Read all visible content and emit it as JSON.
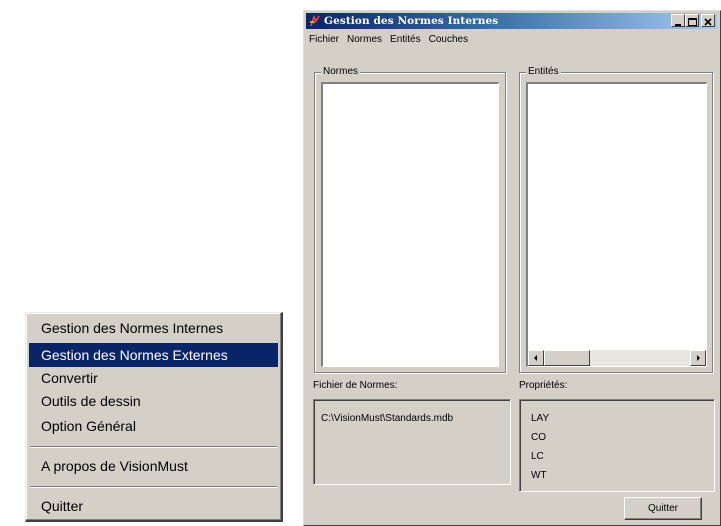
{
  "window": {
    "title": "Gestion des Normes Internes",
    "menu": [
      "Fichier",
      "Normes",
      "Entités",
      "Couches"
    ],
    "normes_group_label": "Normes",
    "entites_group_label": "Entités",
    "fichier_label": "Fichier de Normes:",
    "fichier_value": "C:\\VisionMust\\Standards.mdb",
    "proprietes_label": "Propriétés:",
    "proprietes": [
      "LAY",
      "CO",
      "LC",
      "WT"
    ],
    "quit_button": "Quitter"
  },
  "popup_menu": {
    "items": [
      "Gestion des Normes Internes",
      "Gestion des Normes Externes",
      "Convertir",
      "Outils de dessin",
      "Option Général"
    ],
    "selected_index": 1,
    "about": "A  propos de VisionMust",
    "quit": "Quitter"
  },
  "colors": {
    "title_active": "#0a246a",
    "face": "#d4d0c8",
    "selection": "#0a246a"
  }
}
